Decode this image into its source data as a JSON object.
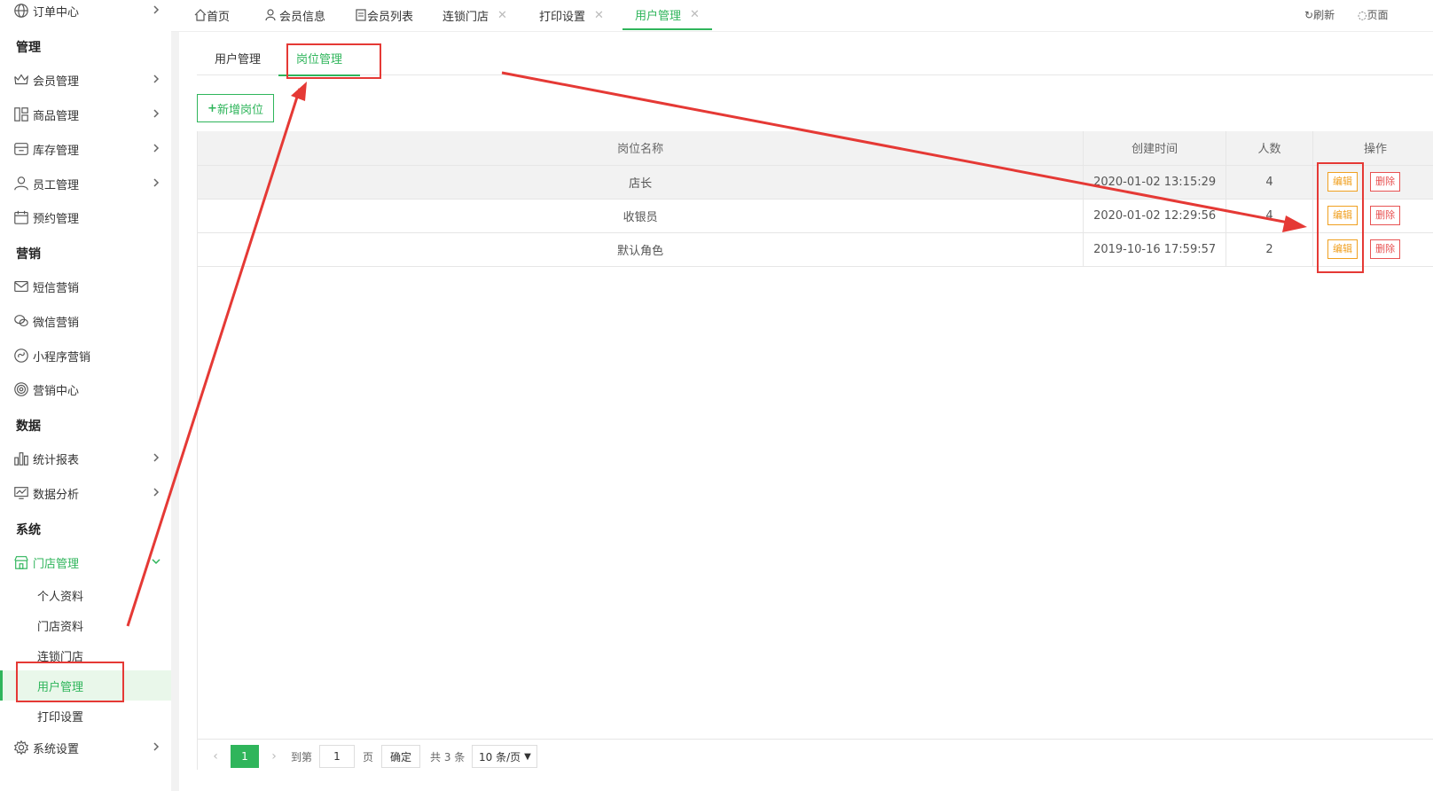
{
  "sidebar": {
    "top_item": "订单中心",
    "groups": [
      {
        "title": "管理"
      },
      {
        "title": "营销"
      },
      {
        "title": "数据"
      },
      {
        "title": "系统"
      }
    ],
    "items": [
      {
        "label": "会员管理",
        "icon": "crown-icon"
      },
      {
        "label": "商品管理",
        "icon": "grid-icon"
      },
      {
        "label": "库存管理",
        "icon": "box-icon"
      },
      {
        "label": "员工管理",
        "icon": "user-icon"
      },
      {
        "label": "预约管理",
        "icon": "calendar-icon"
      },
      {
        "label": "短信营销",
        "icon": "mail-icon"
      },
      {
        "label": "微信营销",
        "icon": "wechat-icon"
      },
      {
        "label": "小程序营销",
        "icon": "miniprogram-icon"
      },
      {
        "label": "营销中心",
        "icon": "target-icon"
      },
      {
        "label": "统计报表",
        "icon": "bar-chart-icon"
      },
      {
        "label": "数据分析",
        "icon": "monitor-chart-icon"
      },
      {
        "label": "门店管理",
        "icon": "store-icon"
      },
      {
        "label": "系统设置",
        "icon": "gear-icon"
      }
    ],
    "store_sub_items": [
      {
        "label": "个人资料"
      },
      {
        "label": "门店资料"
      },
      {
        "label": "连锁门店"
      },
      {
        "label": "用户管理"
      },
      {
        "label": "打印设置"
      }
    ]
  },
  "topbar": {
    "tabs": [
      {
        "label": "首页",
        "icon": "home-icon"
      },
      {
        "label": "会员信息",
        "icon": "users-icon"
      },
      {
        "label": "会员列表",
        "icon": "list-icon"
      },
      {
        "label": "连锁门店",
        "close": "✕"
      },
      {
        "label": "打印设置",
        "close": "✕"
      },
      {
        "label": "用户管理",
        "close": "✕"
      }
    ],
    "refresh": "刷新",
    "page": "页面"
  },
  "subtabs": [
    {
      "label": "用户管理"
    },
    {
      "label": "岗位管理"
    }
  ],
  "add_button": "新增岗位",
  "table": {
    "headers": [
      "岗位名称",
      "创建时间",
      "人数",
      "操作"
    ],
    "rows": [
      {
        "name": "店长",
        "created": "2020-01-02 13:15:29",
        "count": "4"
      },
      {
        "name": "收银员",
        "created": "2020-01-02 12:29:56",
        "count": "4"
      },
      {
        "name": "默认角色",
        "created": "2019-10-16 17:59:57",
        "count": "2"
      }
    ],
    "edit_label": "编辑",
    "delete_label": "删除"
  },
  "pager": {
    "current": "1",
    "goto": "到第",
    "page_input": "1",
    "page_unit": "页",
    "confirm": "确定",
    "total": "共 3 条",
    "page_size": "10 条/页"
  },
  "colors": {
    "accent": "#2fb55b",
    "annotation": "#e53935",
    "edit": "#f0a020",
    "delete": "#e85252"
  }
}
